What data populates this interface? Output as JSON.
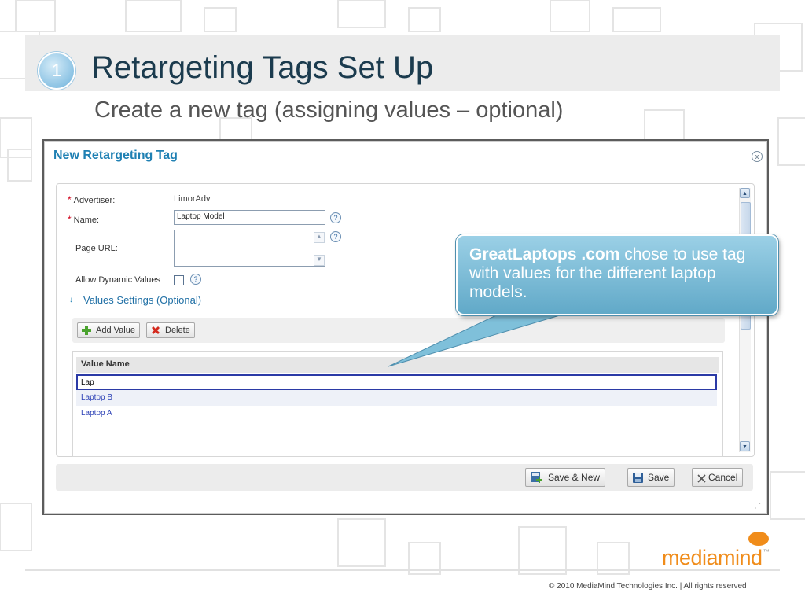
{
  "slide": {
    "step": "1",
    "title": "Retargeting Tags Set Up",
    "subtitle": "Create a new tag (assigning values – optional)"
  },
  "dialog": {
    "title": "New Retargeting Tag",
    "close_icon": "x",
    "fields": {
      "advertiser_label": "Advertiser:",
      "advertiser_value": "LimorAdv",
      "name_label": "Name:",
      "name_value": "Laptop Model",
      "page_url_label": "Page URL:",
      "page_url_value": "",
      "allow_dynamic_label": "Allow Dynamic Values",
      "allow_dynamic_checked": false,
      "required_mark": "*",
      "help_glyph": "?"
    },
    "values_section": {
      "title": "Values Settings (Optional)",
      "add_label": "Add Value",
      "delete_label": "Delete",
      "column_header": "Value Name",
      "edit_value": "Lap",
      "rows": [
        "Laptop B",
        "Laptop A"
      ]
    },
    "buttons": {
      "save_new": "Save & New",
      "save": "Save",
      "cancel": "Cancel"
    }
  },
  "callout": {
    "bold": "GreatLaptops .com",
    "text": " chose to use tag with values for the different laptop models."
  },
  "footer": {
    "brand": "mediamind",
    "tm": "™",
    "copyright": "© 2010 MediaMind Technologies Inc. | All rights reserved"
  },
  "colors": {
    "accent": "#1f80b3",
    "brand": "#f08c1a",
    "callout": "#61a9c8",
    "edit_border": "#2b3aa6"
  }
}
